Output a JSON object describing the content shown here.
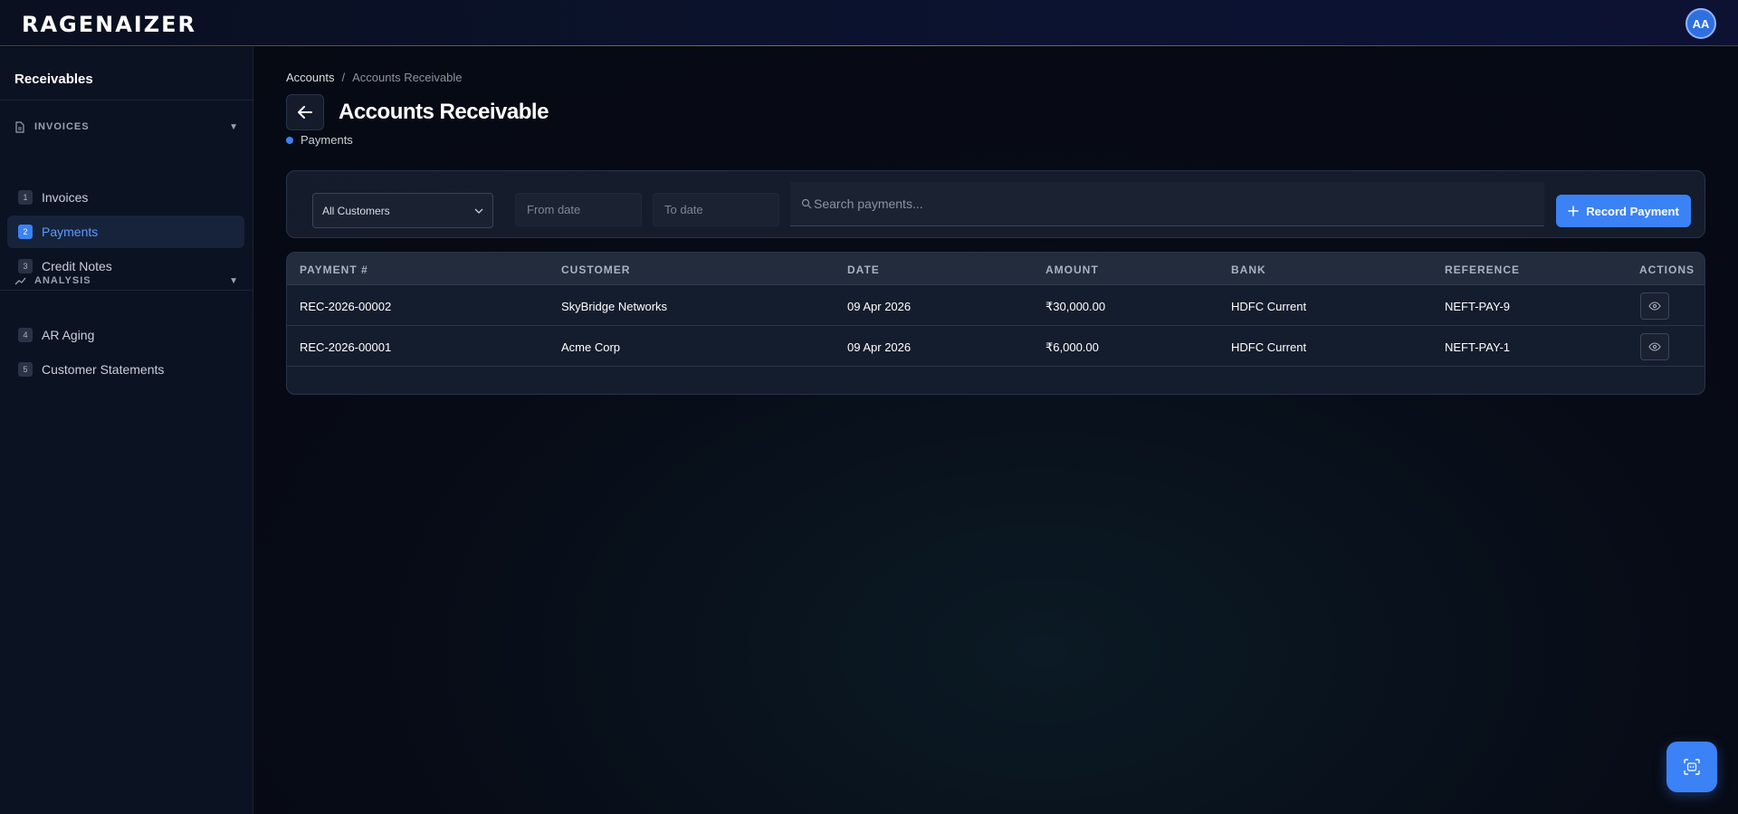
{
  "app": {
    "logo_text": "RAGENAIZER",
    "avatar_initials": "AA"
  },
  "sidebar": {
    "title": "Receivables",
    "sections": [
      {
        "label": "INVOICES",
        "icon": "document-icon",
        "items": [
          {
            "num": "1",
            "label": "Invoices"
          },
          {
            "num": "2",
            "label": "Payments",
            "active": true
          },
          {
            "num": "3",
            "label": "Credit Notes"
          }
        ]
      },
      {
        "label": "ANALYSIS",
        "icon": "trend-icon",
        "items": [
          {
            "num": "4",
            "label": "AR Aging"
          },
          {
            "num": "5",
            "label": "Customer Statements"
          }
        ]
      }
    ]
  },
  "breadcrumb": {
    "parent": "Accounts",
    "separator": "/",
    "current": "Accounts Receivable"
  },
  "page": {
    "title": "Accounts Receivable",
    "subnav": "Payments"
  },
  "filters": {
    "customer_select": "All Customers",
    "from_date_placeholder": "From date",
    "to_date_placeholder": "To date",
    "search_placeholder": "Search payments...",
    "record_button": "Record Payment"
  },
  "table": {
    "columns": [
      "PAYMENT #",
      "CUSTOMER",
      "DATE",
      "AMOUNT",
      "BANK",
      "REFERENCE",
      "ACTIONS"
    ],
    "rows": [
      [
        "REC-2026-00002",
        "SkyBridge Networks",
        "09 Apr 2026",
        "₹30,000.00",
        "HDFC Current",
        "NEFT-PAY-9"
      ],
      [
        "REC-2026-00001",
        "Acme Corp",
        "09 Apr 2026",
        "₹6,000.00",
        "HDFC Current",
        "NEFT-PAY-1"
      ]
    ]
  },
  "colors": {
    "accent": "#3b82f6",
    "background": "#070b16",
    "sidebar": "#0b1222"
  }
}
